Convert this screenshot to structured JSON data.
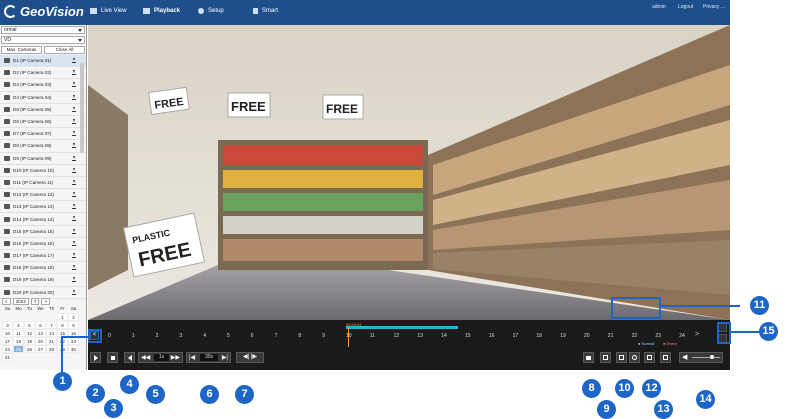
{
  "app": {
    "logo": "GeoVision",
    "nav": [
      "Live View",
      "Playback",
      "Setup",
      "Smart"
    ],
    "top_links": [
      "admin",
      "Logout",
      "Privacy ..."
    ]
  },
  "sidebar": {
    "mode": "ormal",
    "second_select": "VD",
    "max_cameras": "Max. Cameras",
    "close_all": "Close All",
    "cameras": [
      "D1 (IP Camera 01)",
      "D2 (IP Camera 02)",
      "D3 (IP Camera 03)",
      "D4 (IP Camera 04)",
      "D5 (IP Camera 05)",
      "D6 (IP Camera 06)",
      "D7 (IP Camera 07)",
      "D8 (IP Camera 08)",
      "D9 (IP Camera 09)",
      "D10 (IP Camera 10)",
      "D11 (IP Camera 11)",
      "D12 (IP Camera 12)",
      "D13 (IP Camera 13)",
      "D14 (IP Camera 14)",
      "D15 (IP Camera 15)",
      "D16 (IP Camera 16)",
      "D17 (IP Camera 17)",
      "D18 (IP Camera 18)",
      "D19 (IP Camera 19)",
      "D20 (IP Camera 20)"
    ],
    "calendar": {
      "year": "2022",
      "month": "7",
      "weekdays": [
        "Su",
        "Mo",
        "Tu",
        "We",
        "Th",
        "Fr",
        "Sa"
      ],
      "weeks": [
        [
          "",
          "",
          "",
          "",
          "",
          "1",
          "2"
        ],
        [
          "3",
          "4",
          "5",
          "6",
          "7",
          "8",
          "9"
        ],
        [
          "10",
          "11",
          "12",
          "13",
          "14",
          "15",
          "16"
        ],
        [
          "17",
          "18",
          "19",
          "20",
          "21",
          "22",
          "23"
        ],
        [
          "24",
          "25",
          "26",
          "27",
          "28",
          "29",
          "30"
        ],
        [
          "31",
          "",
          "",
          "",
          "",
          "",
          ""
        ]
      ],
      "today": "25"
    }
  },
  "timeline": {
    "hours": [
      "0",
      "1",
      "2",
      "3",
      "4",
      "5",
      "6",
      "7",
      "8",
      "9",
      "10",
      "11",
      "12",
      "13",
      "14",
      "15",
      "16",
      "17",
      "18",
      "19",
      "20",
      "21",
      "22",
      "23",
      "24"
    ],
    "current_label": "09:49:41",
    "legend_normal": "Normal",
    "legend_event": "Event"
  },
  "controls": {
    "speed": "1x",
    "step": "30s"
  },
  "callouts": [
    "1",
    "2",
    "3",
    "4",
    "5",
    "6",
    "7",
    "8",
    "9",
    "10",
    "11",
    "12",
    "13",
    "14",
    "15"
  ],
  "colors": {
    "nav": "#1e4f8c",
    "callout": "#1d66c8",
    "timeline_bar": "#27b1d6",
    "event": "#e04040"
  }
}
